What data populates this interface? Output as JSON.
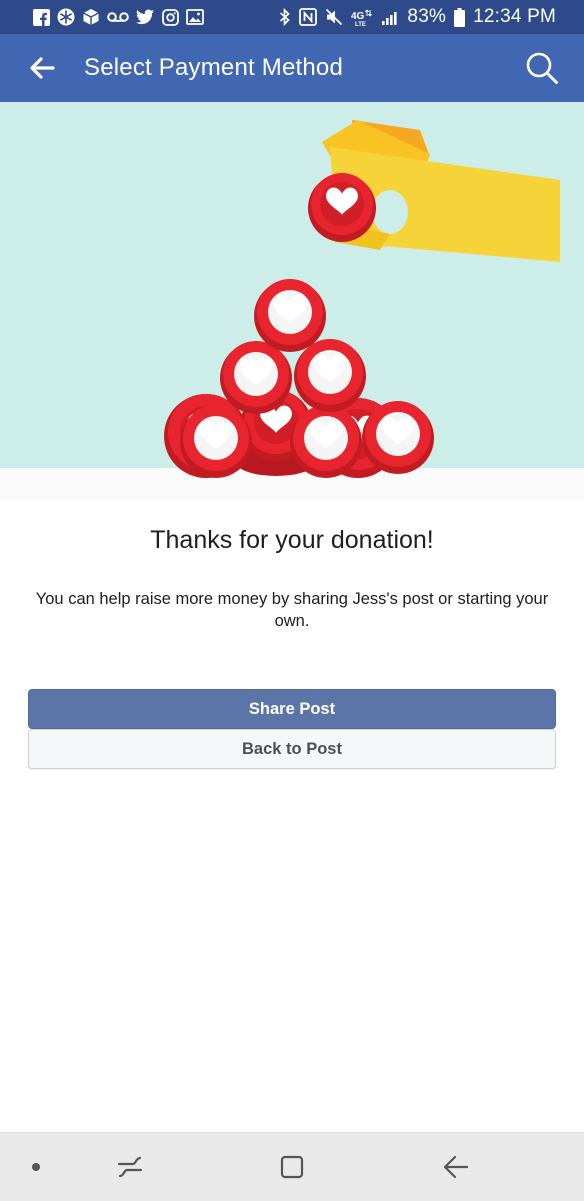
{
  "status_bar": {
    "left_icons": [
      "facebook-icon",
      "snowflake-icon",
      "package-icon",
      "voicemail-icon",
      "twitter-icon",
      "instagram-icon",
      "gallery-icon"
    ],
    "right_icons": [
      "bluetooth-icon",
      "nfc-icon",
      "mute-icon",
      "4g-lte-icon",
      "signal-icon"
    ],
    "battery": "83%",
    "time": "12:34 PM"
  },
  "app_bar": {
    "title": "Select Payment Method",
    "back_icon": "arrow-left-icon",
    "search_icon": "search-icon"
  },
  "hero": {
    "illustration": "paper-hand-placing-heart-coin-on-pile-of-red-heart-coins"
  },
  "content": {
    "heading": "Thanks for your donation!",
    "message": "You can help raise more money by sharing Jess's post or starting your own."
  },
  "buttons": {
    "share_label": "Share Post",
    "back_label": "Back to Post"
  },
  "nav_bar": {
    "items": [
      "dot-icon",
      "recent-apps-icon",
      "home-icon",
      "back-icon"
    ]
  },
  "colors": {
    "status_bar": "#2f4a8a",
    "app_bar": "#4267b2",
    "share_button": "#5b75a8",
    "hero_background": "#cdeee8",
    "heart_coin": "#e8252e",
    "paper_hand": "#f7cf37"
  }
}
